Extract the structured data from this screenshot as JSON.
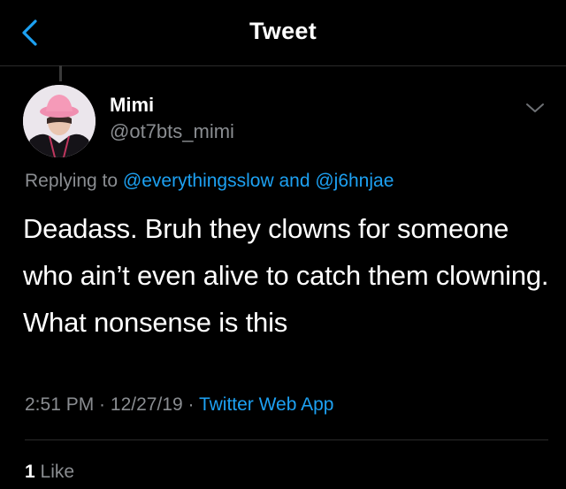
{
  "nav": {
    "title": "Tweet",
    "back_icon": "chevron-left-icon"
  },
  "tweet": {
    "author_name": "Mimi",
    "author_handle": "@ot7bts_mimi",
    "reply_prefix": "Replying to ",
    "reply_user_1": "@everythingsslow",
    "reply_joiner": " and ",
    "reply_user_2": "@j6hnjae",
    "text": "Deadass. Bruh they clowns for someone who ain’t even alive to catch them clowning. What nonsense is this",
    "time": "2:51 PM",
    "sep_1": " · ",
    "date": "12/27/19",
    "sep_2": " · ",
    "source": "Twitter Web App",
    "like_count": "1",
    "like_label": " Like"
  },
  "colors": {
    "background": "#000000",
    "accent": "#1da1f2",
    "secondary_text": "#8a8d91",
    "divider": "#2a2a2a"
  }
}
